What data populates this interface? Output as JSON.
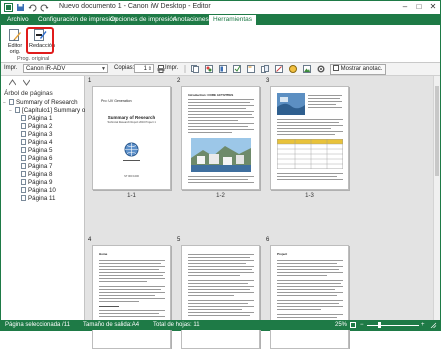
{
  "window": {
    "title": "Nuevo documento 1 - Canon iW Desktop - Editor",
    "controls": [
      "–",
      "□",
      "✕"
    ]
  },
  "ribbon_tabs": [
    "Archivo",
    "Configuración de impresión",
    "Opciones de impresión",
    "Anotaciones",
    "Herramientas"
  ],
  "active_tab": "Herramientas",
  "ribbon": {
    "editor_label": "Editor orig.",
    "redaction_label": "Redacción",
    "group_label": "Prog. original",
    "accent_color": "#1e7a46",
    "highlight_color": "#e01b1b"
  },
  "toolbar": {
    "printer_label": "Impr.",
    "printer_value": "Canon iR-ADV",
    "copies_label": "Copias:",
    "copies_value": "1",
    "print_label": "Impr.",
    "show_annotations": "Mostrar anotac."
  },
  "left_pane": {
    "title": "Árbol de páginas",
    "tree": [
      {
        "label": "Summary of Research",
        "level": 0,
        "toggle": "−"
      },
      {
        "label": "[Capítulo1] Summary of R",
        "level": 1,
        "toggle": "−"
      },
      {
        "label": "Página 1",
        "level": 2,
        "toggle": ""
      },
      {
        "label": "Página 2",
        "level": 2,
        "toggle": ""
      },
      {
        "label": "Página 3",
        "level": 2,
        "toggle": ""
      },
      {
        "label": "Página 4",
        "level": 2,
        "toggle": ""
      },
      {
        "label": "Página 5",
        "level": 2,
        "toggle": ""
      },
      {
        "label": "Página 6",
        "level": 2,
        "toggle": ""
      },
      {
        "label": "Página 7",
        "level": 2,
        "toggle": ""
      },
      {
        "label": "Página 8",
        "level": 2,
        "toggle": ""
      },
      {
        "label": "Página 9",
        "level": 2,
        "toggle": ""
      },
      {
        "label": "Página 10",
        "level": 2,
        "toggle": ""
      },
      {
        "label": "Página 11",
        "level": 2,
        "toggle": ""
      }
    ]
  },
  "pages": [
    {
      "number": "1",
      "caption": "1-1",
      "heading": "Pro: UV Generation",
      "title": "Summary of Research",
      "subtitle": "Technical Research Report 2016 Project 1",
      "footer": "ST 000 1000"
    },
    {
      "number": "2",
      "caption": "1-2",
      "heading": "Introduction: CORE ACTIVITIES"
    },
    {
      "number": "3",
      "caption": "1-3",
      "heading": ""
    },
    {
      "number": "4",
      "caption": "",
      "heading": "Home"
    },
    {
      "number": "5",
      "caption": "",
      "heading": ""
    },
    {
      "number": "6",
      "caption": "",
      "heading": "Project"
    }
  ],
  "status": {
    "selected": "Página seleccionada /11",
    "output_size": "Tamaño de salida:A4",
    "total": "Total de hojas: 11",
    "zoom": "25%"
  }
}
